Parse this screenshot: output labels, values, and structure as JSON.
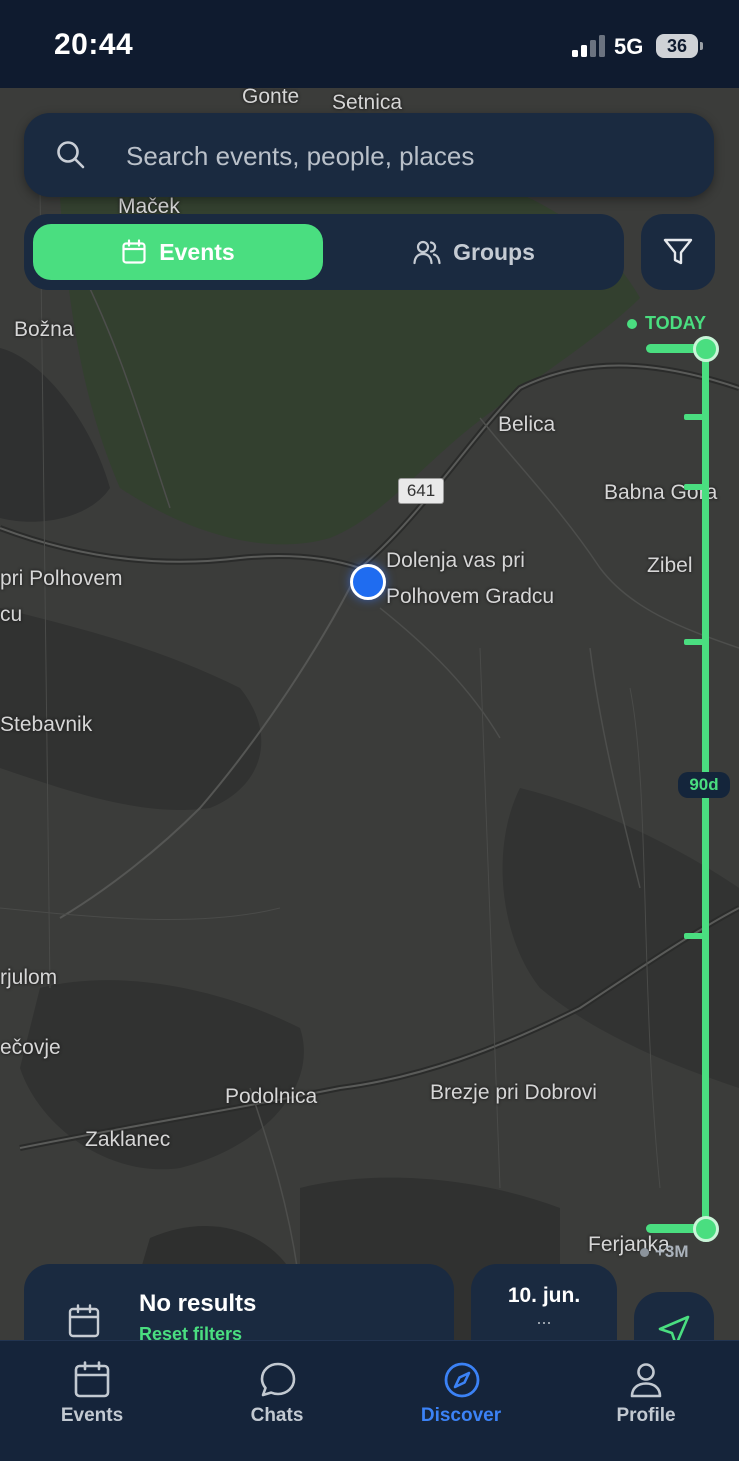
{
  "status_bar": {
    "time": "20:44",
    "network": "5G",
    "battery": "36"
  },
  "map": {
    "labels": [
      "Gonte",
      "Setnica",
      "Maček",
      "Božna",
      "Belica",
      "Babna Gora",
      "Zibel",
      "Dolenja vas pri",
      "Polhovem Gradcu",
      "pri Polhovem",
      "cu",
      "Stebavnik",
      "rjulom",
      "ečovje",
      "Podolnica",
      "Brezje pri Dobrovi",
      "Zaklanec",
      "Ferjanka"
    ],
    "road_number": "641"
  },
  "search": {
    "placeholder": "Search events, people, places"
  },
  "segment": {
    "events_label": "Events",
    "groups_label": "Groups",
    "selected": "events"
  },
  "timeline": {
    "start_label": "TODAY",
    "range_badge": "90d",
    "end_label": "+3M"
  },
  "results": {
    "title": "No results",
    "link": "Reset filters"
  },
  "date_card": {
    "date": "10. jun.",
    "dots": "..."
  },
  "tabbar": {
    "items": [
      {
        "label": "Events",
        "icon": "calendar-icon"
      },
      {
        "label": "Chats",
        "icon": "chat-bubble-icon"
      },
      {
        "label": "Discover",
        "icon": "compass-icon",
        "active": true
      },
      {
        "label": "Profile",
        "icon": "person-icon"
      }
    ]
  },
  "colors": {
    "accent": "#4ade80",
    "active_tab": "#3b82f6",
    "panel": "#1a2a40",
    "status_bar": "#0f1b2f"
  }
}
